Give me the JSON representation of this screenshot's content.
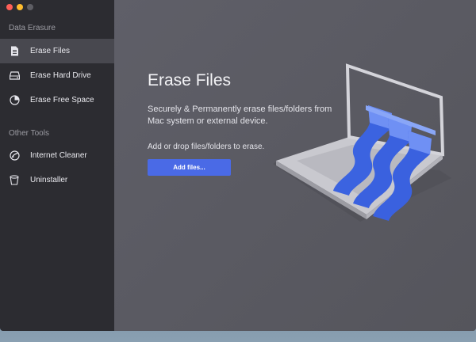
{
  "sidebar": {
    "sections": [
      {
        "title": "Data Erasure",
        "items": [
          {
            "label": "Erase Files",
            "icon": "document-icon",
            "active": true
          },
          {
            "label": "Erase Hard Drive",
            "icon": "hard-drive-icon",
            "active": false
          },
          {
            "label": "Erase Free Space",
            "icon": "pie-chart-icon",
            "active": false
          }
        ]
      },
      {
        "title": "Other Tools",
        "items": [
          {
            "label": "Internet Cleaner",
            "icon": "globe-icon",
            "active": false
          },
          {
            "label": "Uninstaller",
            "icon": "trash-icon",
            "active": false
          }
        ]
      }
    ]
  },
  "main": {
    "title": "Erase Files",
    "description": "Securely & Permanently erase files/folders from Mac system or external device.",
    "hint": "Add or drop files/folders to erase.",
    "add_button": "Add files...",
    "illustration": "laptop-shredder-icon"
  },
  "colors": {
    "sidebar_bg": "#2c2c31",
    "sidebar_active": "#48484f",
    "main_bg": "#5a5a62",
    "accent": "#4a6ae6",
    "shred_blue": "#3b63e0"
  }
}
